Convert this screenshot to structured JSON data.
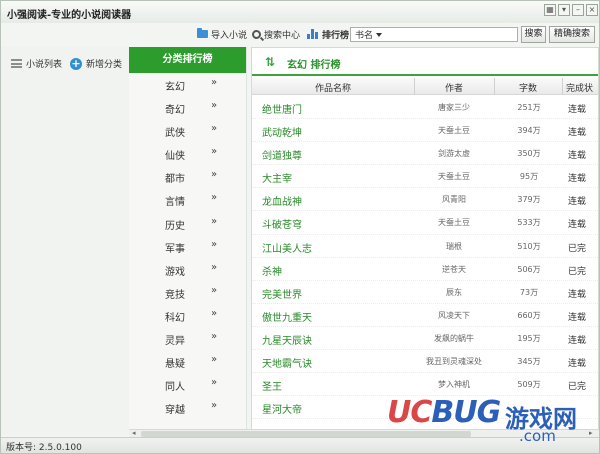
{
  "app": {
    "title": "小强阅读-专业的小说阅读器"
  },
  "window_buttons": [
    {
      "name": "skin-button",
      "icon": "skin-icon",
      "glyph": "▦"
    },
    {
      "name": "menu-button",
      "icon": "menu-icon",
      "glyph": "▾"
    },
    {
      "name": "minimize-button",
      "icon": "minimize-icon",
      "glyph": "–"
    },
    {
      "name": "close-button",
      "icon": "close-icon",
      "glyph": "×"
    }
  ],
  "toolbar": {
    "import_label": "导入小说",
    "search_center_label": "搜索中心",
    "ranking_label": "排行榜",
    "search_type_value": "书名",
    "search_button": "搜索",
    "exact_search_button": "精确搜索"
  },
  "left_panel": {
    "novel_list_label": "小说列表",
    "new_category_label": "新增分类"
  },
  "categories": {
    "header": "分类排行榜",
    "items": [
      "玄幻",
      "奇幻",
      "武侠",
      "仙侠",
      "都市",
      "言情",
      "历史",
      "军事",
      "游戏",
      "竞技",
      "科幻",
      "灵异",
      "悬疑",
      "同人",
      "穿越"
    ],
    "arrow": "»"
  },
  "main": {
    "rank_title": "玄幻 排行榜",
    "columns": {
      "title": "作品名称",
      "author": "作者",
      "words": "字数",
      "status": "完成状"
    },
    "rows": [
      {
        "title": "绝世唐门",
        "author": "唐家三少",
        "words": "251万",
        "status": "连载"
      },
      {
        "title": "武动乾坤",
        "author": "天蚕土豆",
        "words": "394万",
        "status": "连载"
      },
      {
        "title": "剑道独尊",
        "author": "剑游太虚",
        "words": "350万",
        "status": "连载"
      },
      {
        "title": "大主宰",
        "author": "天蚕土豆",
        "words": "95万",
        "status": "连载"
      },
      {
        "title": "龙血战神",
        "author": "风青阳",
        "words": "379万",
        "status": "连载"
      },
      {
        "title": "斗破苍穹",
        "author": "天蚕土豆",
        "words": "533万",
        "status": "连载"
      },
      {
        "title": "江山美人志",
        "author": "瑞根",
        "words": "510万",
        "status": "已完"
      },
      {
        "title": "杀神",
        "author": "逆苍天",
        "words": "506万",
        "status": "已完"
      },
      {
        "title": "完美世界",
        "author": "辰东",
        "words": "73万",
        "status": "连载"
      },
      {
        "title": "傲世九重天",
        "author": "风凌天下",
        "words": "660万",
        "status": "连载"
      },
      {
        "title": "九星天辰诀",
        "author": "发飙的蜗牛",
        "words": "195万",
        "status": "连载"
      },
      {
        "title": "天地霸气诀",
        "author": "我丑到灵魂深处",
        "words": "345万",
        "status": "连载"
      },
      {
        "title": "圣王",
        "author": "梦入神机",
        "words": "509万",
        "status": "已完"
      },
      {
        "title": "星河大帝",
        "author": "",
        "words": "",
        "status": ""
      }
    ]
  },
  "status_bar": {
    "version": "版本号: 2.5.0.100"
  },
  "watermark": {
    "uc": "UC",
    "bug": "BUG",
    "game": "游戏网",
    "com": ".com"
  },
  "colors": {
    "accent_green": "#2c9c2c",
    "title_green": "#2a8a2a",
    "icon_blue": "#2f8fd0"
  }
}
